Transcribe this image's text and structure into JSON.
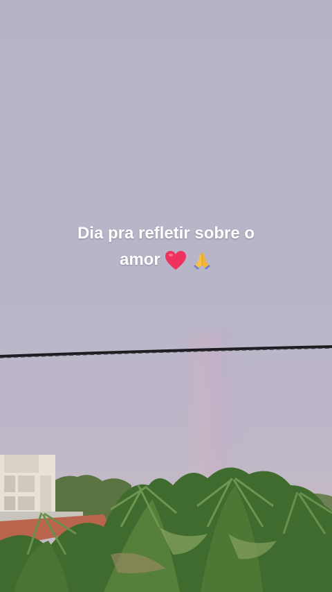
{
  "story": {
    "caption_line1": "Dia pra refletir sobre o",
    "caption_line2": "amor",
    "emojis": [
      "red-heart",
      "folded-hands"
    ]
  },
  "colors": {
    "sky": "#b6b4c8",
    "caption_text": "#ffffff",
    "foliage": "#3f6b2e",
    "roof": "#b9654e",
    "wire": "#1c1c22"
  }
}
